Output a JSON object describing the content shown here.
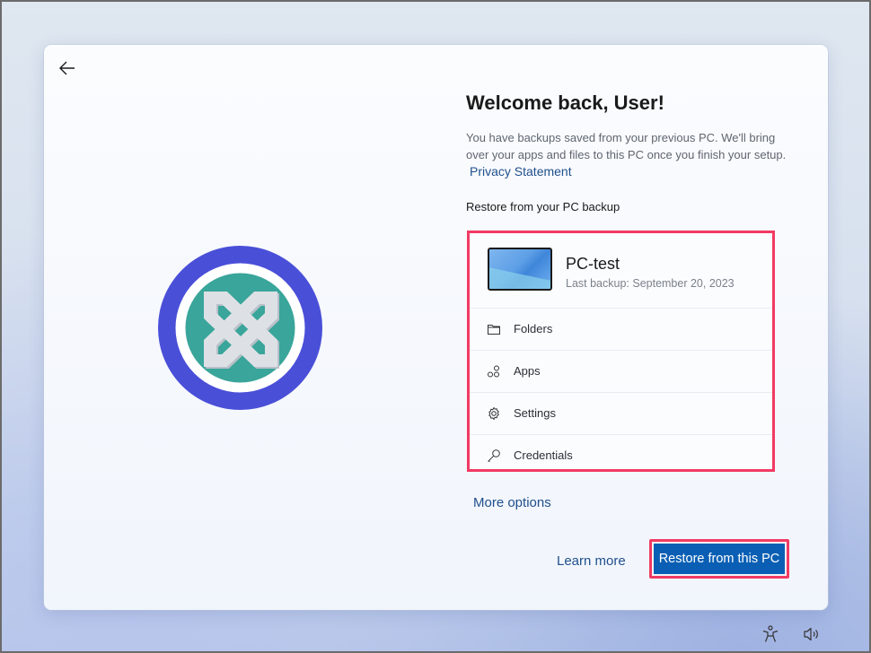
{
  "header": {
    "back_icon": "arrow-left-icon"
  },
  "logo": {
    "semantic": "knot-logo",
    "ring_color": "#4a4fd8",
    "inner_color": "#3aa59a",
    "knot_color": "#dde1e6"
  },
  "main": {
    "title": "Welcome back, User!",
    "description": "You have backups saved from your previous PC. We'll bring over your apps and files to this PC once you finish your setup.",
    "privacy_link": "Privacy Statement",
    "section_label": "Restore from your PC backup",
    "backup": {
      "pc_name": "PC-test",
      "last_backup": "Last backup: September 20, 2023",
      "items": [
        {
          "label": "Folders",
          "icon": "folder-icon"
        },
        {
          "label": "Apps",
          "icon": "apps-icon"
        },
        {
          "label": "Settings",
          "icon": "gear-icon"
        },
        {
          "label": "Credentials",
          "icon": "key-icon"
        }
      ]
    },
    "more_options": "More options",
    "learn_more": "Learn more",
    "restore_button": "Restore from this PC"
  },
  "tray": {
    "accessibility_icon": "accessibility-icon",
    "volume_icon": "volume-icon"
  },
  "colors": {
    "accent": "#0a5fb4",
    "highlight_border": "#f23a63",
    "link": "#1f4f8c"
  }
}
